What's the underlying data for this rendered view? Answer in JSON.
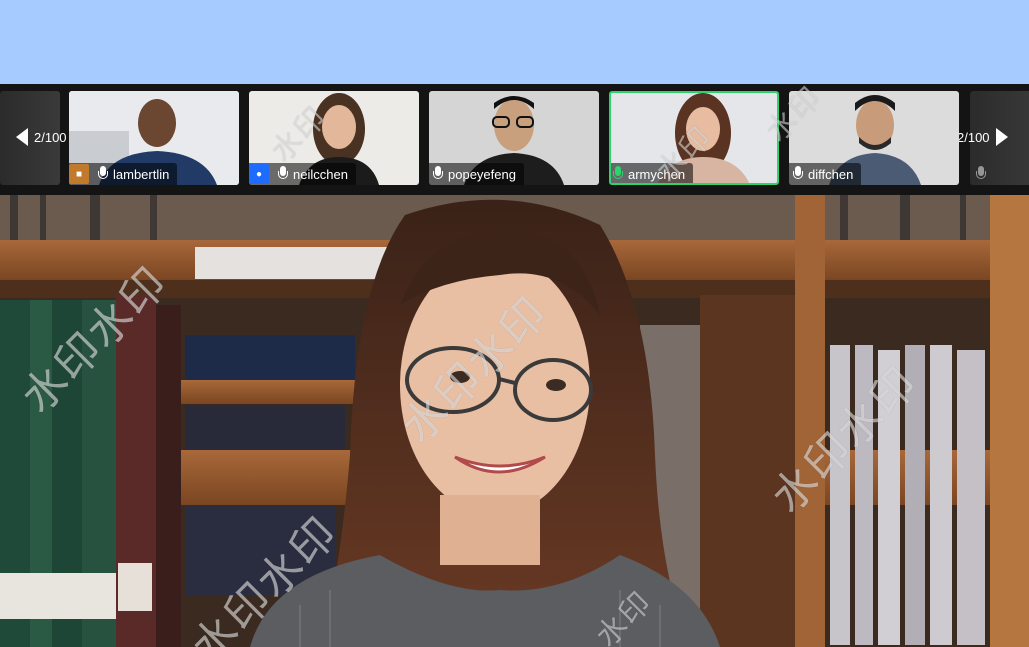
{
  "filmstrip": {
    "pager_left": "2/100",
    "pager_right": "2/100",
    "participants": [
      {
        "name": "lambertlin",
        "mic_color": "#ffffff",
        "badge": "host",
        "badge_color": "#c17a2c"
      },
      {
        "name": "neilcchen",
        "mic_color": "#ffffff",
        "badge": "cohost",
        "badge_color": "#1e6cff"
      },
      {
        "name": "popeyefeng",
        "mic_color": "#ffffff"
      },
      {
        "name": "armychen",
        "mic_color": "#2ed36b",
        "active": true
      },
      {
        "name": "diffchen",
        "mic_color": "#ffffff"
      }
    ]
  },
  "watermark": {
    "text": "水印水印",
    "small_text": "水印"
  },
  "colors": {
    "background": "#a6cbff",
    "strip": "#141414",
    "active_border": "#2ed36b"
  },
  "icons": {
    "prev": "triangle-left-icon",
    "next": "triangle-right-icon",
    "mic": "microphone-icon"
  }
}
